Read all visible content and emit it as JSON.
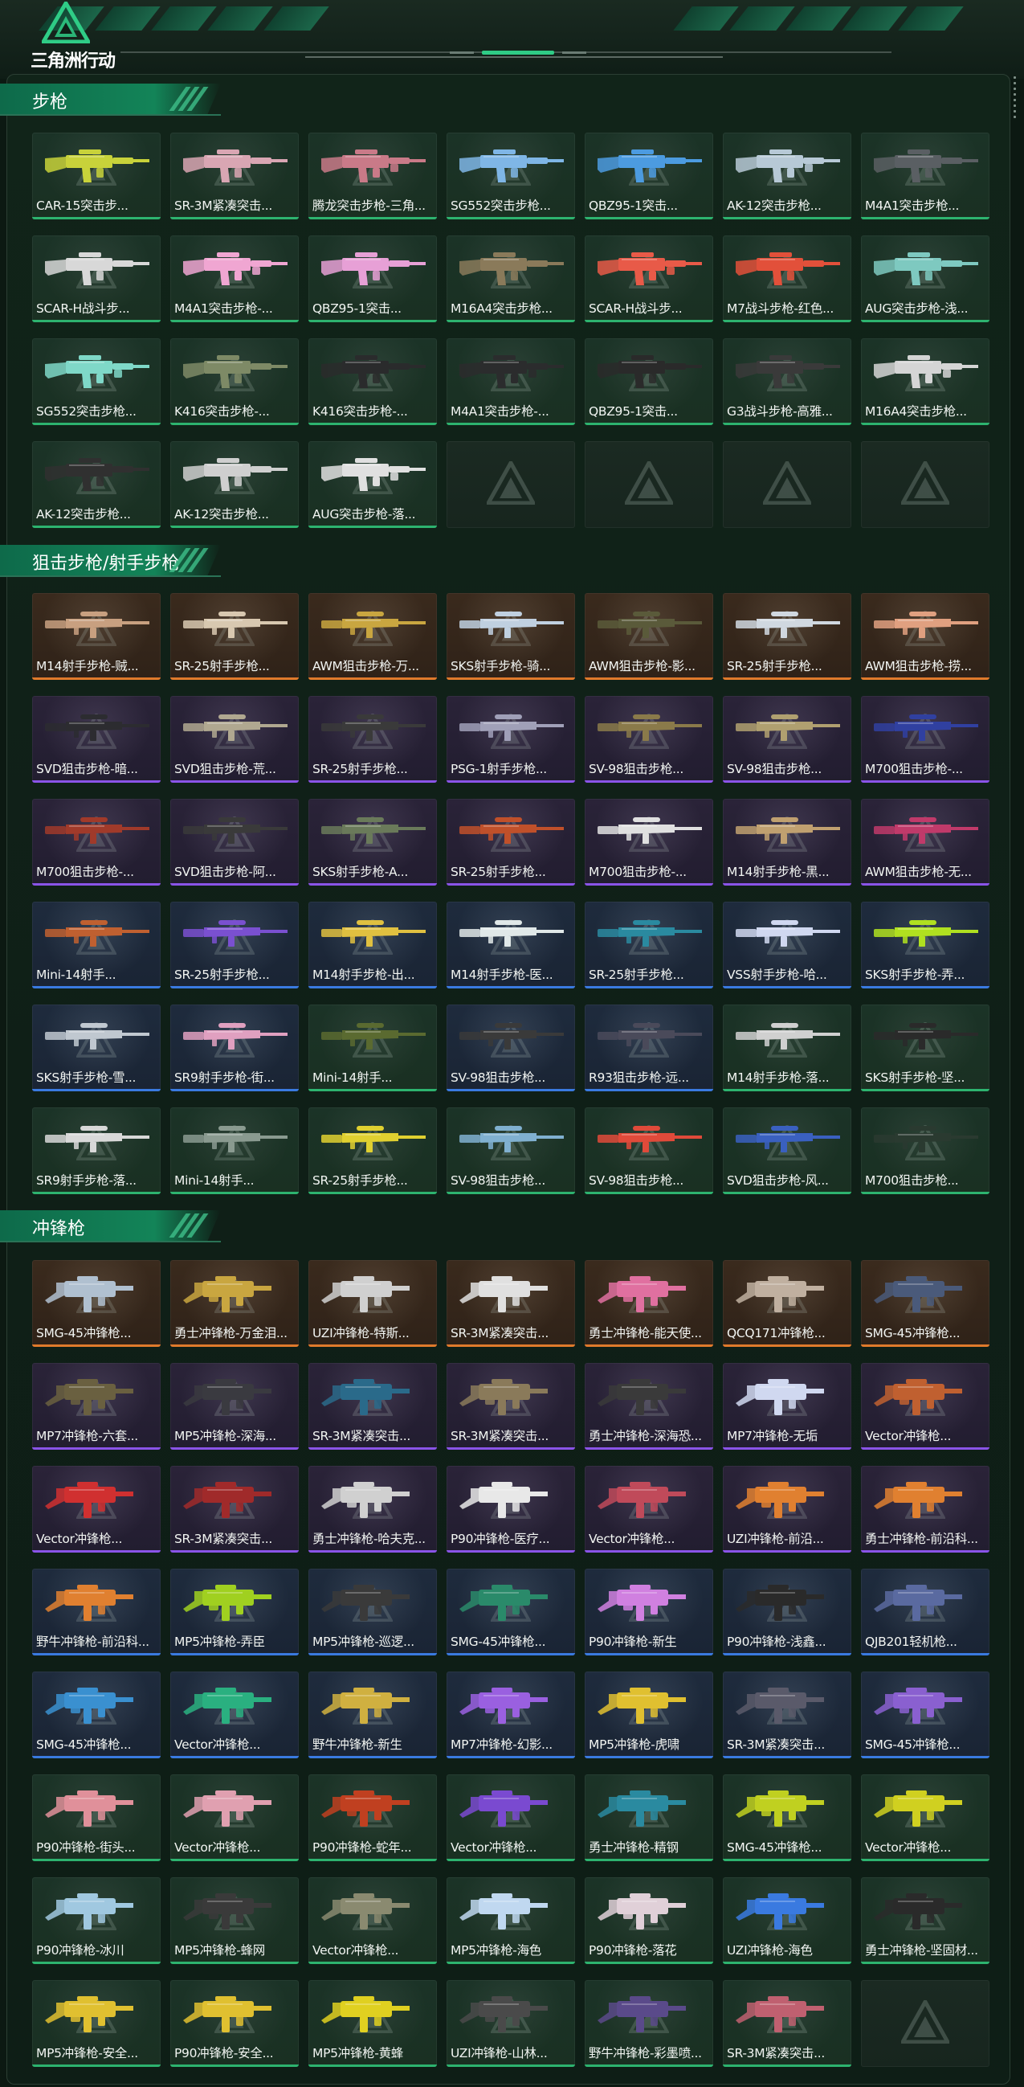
{
  "app": {
    "title": "三角洲行动",
    "accent_color": "#2fcc86"
  },
  "sections": [
    {
      "title": "步枪",
      "items": [
        {
          "label": "CAR-15突击步...",
          "rarity": "green",
          "icon": "assault-rifle-icon",
          "color": "#c8d23a"
        },
        {
          "label": "SR-3M紧凑突击...",
          "rarity": "green",
          "icon": "assault-rifle-icon",
          "color": "#d9a6b3"
        },
        {
          "label": "腾龙突击步枪-三角...",
          "rarity": "green",
          "icon": "assault-rifle-icon",
          "color": "#c97a88"
        },
        {
          "label": "SG552突击步枪...",
          "rarity": "green",
          "icon": "assault-rifle-icon",
          "color": "#7fb6e6"
        },
        {
          "label": "QBZ95-1突击...",
          "rarity": "green",
          "icon": "assault-rifle-icon",
          "color": "#4c9be0"
        },
        {
          "label": "AK-12突击步枪...",
          "rarity": "green",
          "icon": "assault-rifle-icon",
          "color": "#b7c9d6"
        },
        {
          "label": "M4A1突击步枪...",
          "rarity": "green",
          "icon": "assault-rifle-icon",
          "color": "#5a5f63"
        },
        {
          "label": "SCAR-H战斗步...",
          "rarity": "green",
          "icon": "assault-rifle-icon",
          "color": "#d8d8d8"
        },
        {
          "label": "M4A1突击步枪-...",
          "rarity": "green",
          "icon": "assault-rifle-icon",
          "color": "#f0a6d2"
        },
        {
          "label": "QBZ95-1突击...",
          "rarity": "green",
          "icon": "assault-rifle-icon",
          "color": "#e7a0d6"
        },
        {
          "label": "M16A4突击步枪...",
          "rarity": "green",
          "icon": "assault-rifle-icon",
          "color": "#8a7a5a"
        },
        {
          "label": "SCAR-H战斗步...",
          "rarity": "green",
          "icon": "assault-rifle-icon",
          "color": "#e85a48"
        },
        {
          "label": "M7战斗步枪-红色...",
          "rarity": "green",
          "icon": "assault-rifle-icon",
          "color": "#e2503a"
        },
        {
          "label": "AUG突击步枪-浅...",
          "rarity": "green",
          "icon": "assault-rifle-icon",
          "color": "#7ec9c0"
        },
        {
          "label": "SG552突击步枪...",
          "rarity": "green",
          "icon": "assault-rifle-icon",
          "color": "#7fd8c8"
        },
        {
          "label": "K416突击步枪-...",
          "rarity": "green",
          "icon": "assault-rifle-icon",
          "color": "#7e8a66"
        },
        {
          "label": "K416突击步枪-...",
          "rarity": "green",
          "icon": "assault-rifle-icon",
          "color": "#2a2b2c"
        },
        {
          "label": "M4A1突击步枪-...",
          "rarity": "green",
          "icon": "assault-rifle-icon",
          "color": "#2b2c2d"
        },
        {
          "label": "QBZ95-1突击...",
          "rarity": "green",
          "icon": "assault-rifle-icon",
          "color": "#2a2a2a"
        },
        {
          "label": "G3战斗步枪-高雅...",
          "rarity": "green",
          "icon": "assault-rifle-icon",
          "color": "#3a3a3a"
        },
        {
          "label": "M16A4突击步枪...",
          "rarity": "green",
          "icon": "assault-rifle-icon",
          "color": "#d5d5d5"
        },
        {
          "label": "AK-12突击步枪...",
          "rarity": "green",
          "icon": "assault-rifle-icon",
          "color": "#303030"
        },
        {
          "label": "AK-12突击步枪...",
          "rarity": "green",
          "icon": "assault-rifle-icon",
          "color": "#cfcfcf"
        },
        {
          "label": "AUG突击步枪-落...",
          "rarity": "green",
          "icon": "assault-rifle-icon",
          "color": "#e0e0e0"
        },
        {
          "label": "",
          "rarity": "empty",
          "icon": "delta-watermark-icon",
          "color": ""
        },
        {
          "label": "",
          "rarity": "empty",
          "icon": "delta-watermark-icon",
          "color": ""
        },
        {
          "label": "",
          "rarity": "empty",
          "icon": "delta-watermark-icon",
          "color": ""
        },
        {
          "label": "",
          "rarity": "empty",
          "icon": "delta-watermark-icon",
          "color": ""
        }
      ]
    },
    {
      "title": "狙击步枪/射手步枪",
      "items": [
        {
          "label": "M14射手步枪-贼...",
          "rarity": "orange",
          "icon": "sniper-rifle-icon",
          "color": "#c8a080"
        },
        {
          "label": "SR-25射手步枪...",
          "rarity": "orange",
          "icon": "sniper-rifle-icon",
          "color": "#d8c8b0"
        },
        {
          "label": "AWM狙击步枪-万...",
          "rarity": "orange",
          "icon": "sniper-rifle-icon",
          "color": "#c9a640"
        },
        {
          "label": "SKS射手步枪-骑...",
          "rarity": "orange",
          "icon": "sniper-rifle-icon",
          "color": "#c0d0e0"
        },
        {
          "label": "AWM狙击步枪-影...",
          "rarity": "orange",
          "icon": "sniper-rifle-icon",
          "color": "#5a5a3a"
        },
        {
          "label": "SR-25射手步枪...",
          "rarity": "orange",
          "icon": "sniper-rifle-icon",
          "color": "#d0d8e0"
        },
        {
          "label": "AWM狙击步枪-捞...",
          "rarity": "orange",
          "icon": "sniper-rifle-icon",
          "color": "#e0a080"
        },
        {
          "label": "SVD狙击步枪-暗...",
          "rarity": "purple",
          "icon": "sniper-rifle-icon",
          "color": "#2c2c30"
        },
        {
          "label": "SVD狙击步枪-荒...",
          "rarity": "purple",
          "icon": "sniper-rifle-icon",
          "color": "#b0a890"
        },
        {
          "label": "SR-25射手步枪...",
          "rarity": "purple",
          "icon": "sniper-rifle-icon",
          "color": "#3a3a3a"
        },
        {
          "label": "PSG-1射手步枪...",
          "rarity": "purple",
          "icon": "sniper-rifle-icon",
          "color": "#a0a0b8"
        },
        {
          "label": "SV-98狙击步枪...",
          "rarity": "purple",
          "icon": "sniper-rifle-icon",
          "color": "#8a7a4a"
        },
        {
          "label": "SV-98狙击步枪...",
          "rarity": "purple",
          "icon": "sniper-rifle-icon",
          "color": "#b0a070"
        },
        {
          "label": "M700狙击步枪-...",
          "rarity": "purple",
          "icon": "sniper-rifle-icon",
          "color": "#3040a0"
        },
        {
          "label": "M700狙击步枪-...",
          "rarity": "purple",
          "icon": "sniper-rifle-icon",
          "color": "#a03a2a"
        },
        {
          "label": "SVD狙击步枪-阿...",
          "rarity": "purple",
          "icon": "sniper-rifle-icon",
          "color": "#3a3a3a"
        },
        {
          "label": "SKS射手步枪-A...",
          "rarity": "purple",
          "icon": "sniper-rifle-icon",
          "color": "#6a7a5a"
        },
        {
          "label": "SR-25射手步枪...",
          "rarity": "purple",
          "icon": "sniper-rifle-icon",
          "color": "#c0502a"
        },
        {
          "label": "M700狙击步枪-...",
          "rarity": "purple",
          "icon": "sniper-rifle-icon",
          "color": "#e0e0e0"
        },
        {
          "label": "M14射手步枪-黑...",
          "rarity": "purple",
          "icon": "sniper-rifle-icon",
          "color": "#c0a070"
        },
        {
          "label": "AWM狙击步枪-无...",
          "rarity": "purple",
          "icon": "sniper-rifle-icon",
          "color": "#c03a6a"
        },
        {
          "label": "Mini-14射手...",
          "rarity": "blue",
          "icon": "sniper-rifle-icon",
          "color": "#c06030"
        },
        {
          "label": "SR-25射手步枪...",
          "rarity": "blue",
          "icon": "sniper-rifle-icon",
          "color": "#7a50d0"
        },
        {
          "label": "M14射手步枪-出...",
          "rarity": "blue",
          "icon": "sniper-rifle-icon",
          "color": "#e0c040"
        },
        {
          "label": "M14射手步枪-医...",
          "rarity": "blue",
          "icon": "sniper-rifle-icon",
          "color": "#e0e8e8"
        },
        {
          "label": "SR-25射手步枪...",
          "rarity": "blue",
          "icon": "sniper-rifle-icon",
          "color": "#2a8aa0"
        },
        {
          "label": "VSS射手步枪-哈...",
          "rarity": "blue",
          "icon": "sniper-rifle-icon",
          "color": "#d0d8f0"
        },
        {
          "label": "SKS射手步枪-弄...",
          "rarity": "blue",
          "icon": "sniper-rifle-icon",
          "color": "#b0e020"
        },
        {
          "label": "SKS射手步枪-雪...",
          "rarity": "blue",
          "icon": "sniper-rifle-icon",
          "color": "#c0c8d0"
        },
        {
          "label": "SR9射手步枪-街...",
          "rarity": "blue",
          "icon": "sniper-rifle-icon",
          "color": "#e0a0c0"
        },
        {
          "label": "Mini-14射手...",
          "rarity": "green",
          "icon": "sniper-rifle-icon",
          "color": "#5a6a30"
        },
        {
          "label": "SV-98狙击步枪...",
          "rarity": "blue",
          "icon": "sniper-rifle-icon",
          "color": "#3a3a3a"
        },
        {
          "label": "R93狙击步枪-远...",
          "rarity": "blue",
          "icon": "sniper-rifle-icon",
          "color": "#4a4a5a"
        },
        {
          "label": "M14射手步枪-落...",
          "rarity": "green",
          "icon": "sniper-rifle-icon",
          "color": "#d0d0d0"
        },
        {
          "label": "SKS射手步枪-坚...",
          "rarity": "green",
          "icon": "sniper-rifle-icon",
          "color": "#2a2a2a"
        },
        {
          "label": "SR9射手步枪-落...",
          "rarity": "green",
          "icon": "sniper-rifle-icon",
          "color": "#d8d8d8"
        },
        {
          "label": "Mini-14射手...",
          "rarity": "green",
          "icon": "sniper-rifle-icon",
          "color": "#8a9a90"
        },
        {
          "label": "SR-25射手步枪...",
          "rarity": "green",
          "icon": "sniper-rifle-icon",
          "color": "#e0d030"
        },
        {
          "label": "SV-98狙击步枪...",
          "rarity": "green",
          "icon": "sniper-rifle-icon",
          "color": "#80b0d0"
        },
        {
          "label": "SV-98狙击步枪...",
          "rarity": "green",
          "icon": "sniper-rifle-icon",
          "color": "#e04a3a"
        },
        {
          "label": "SVD狙击步枪-风...",
          "rarity": "green",
          "icon": "sniper-rifle-icon",
          "color": "#3a60c0"
        },
        {
          "label": "M700狙击步枪...",
          "rarity": "green",
          "icon": "sniper-rifle-icon",
          "color": "#2a3a30"
        }
      ]
    },
    {
      "title": "冲锋枪",
      "items": [
        {
          "label": "SMG-45冲锋枪...",
          "rarity": "orange",
          "icon": "smg-icon",
          "color": "#b0c0d0"
        },
        {
          "label": "勇士冲锋枪-万金泪...",
          "rarity": "orange",
          "icon": "smg-icon",
          "color": "#c9a640"
        },
        {
          "label": "UZI冲锋枪-特斯...",
          "rarity": "orange",
          "icon": "smg-icon",
          "color": "#d0d0d0"
        },
        {
          "label": "SR-3M紧凑突击...",
          "rarity": "orange",
          "icon": "smg-icon",
          "color": "#e0e0e0"
        },
        {
          "label": "勇士冲锋枪-能天使...",
          "rarity": "orange",
          "icon": "smg-icon",
          "color": "#e070a0"
        },
        {
          "label": "QCQ171冲锋枪...",
          "rarity": "orange",
          "icon": "smg-icon",
          "color": "#c0b0a0"
        },
        {
          "label": "SMG-45冲锋枪...",
          "rarity": "orange",
          "icon": "smg-icon",
          "color": "#4a5a7a"
        },
        {
          "label": "MP7冲锋枪-六套...",
          "rarity": "purple",
          "icon": "smg-icon",
          "color": "#6a6040"
        },
        {
          "label": "MP5冲锋枪-深海...",
          "rarity": "purple",
          "icon": "smg-icon",
          "color": "#3a3a40"
        },
        {
          "label": "SR-3M紧凑突击...",
          "rarity": "purple",
          "icon": "smg-icon",
          "color": "#2a6a8a"
        },
        {
          "label": "SR-3M紧凑突击...",
          "rarity": "purple",
          "icon": "smg-icon",
          "color": "#8a7a5a"
        },
        {
          "label": "勇士冲锋枪-深海恐...",
          "rarity": "purple",
          "icon": "smg-icon",
          "color": "#3a3a3a"
        },
        {
          "label": "MP7冲锋枪-无垢",
          "rarity": "purple",
          "icon": "smg-icon",
          "color": "#d0d8f0"
        },
        {
          "label": "Vector冲锋枪...",
          "rarity": "purple",
          "icon": "smg-icon",
          "color": "#c06030"
        },
        {
          "label": "Vector冲锋枪...",
          "rarity": "purple",
          "icon": "smg-icon",
          "color": "#d03030"
        },
        {
          "label": "SR-3M紧凑突击...",
          "rarity": "purple",
          "icon": "smg-icon",
          "color": "#a02a2a"
        },
        {
          "label": "勇士冲锋枪-哈夫克...",
          "rarity": "purple",
          "icon": "smg-icon",
          "color": "#d0d0d0"
        },
        {
          "label": "P90冲锋枪-医疗...",
          "rarity": "purple",
          "icon": "smg-icon",
          "color": "#e8e8e8"
        },
        {
          "label": "Vector冲锋枪...",
          "rarity": "purple",
          "icon": "smg-icon",
          "color": "#c04a5a"
        },
        {
          "label": "UZI冲锋枪-前沿...",
          "rarity": "purple",
          "icon": "smg-icon",
          "color": "#e08030"
        },
        {
          "label": "勇士冲锋枪-前沿科...",
          "rarity": "purple",
          "icon": "smg-icon",
          "color": "#e08030"
        },
        {
          "label": "野牛冲锋枪-前沿科...",
          "rarity": "blue",
          "icon": "smg-icon",
          "color": "#e08030"
        },
        {
          "label": "MP5冲锋枪-弄臣",
          "rarity": "blue",
          "icon": "smg-icon",
          "color": "#a0d020"
        },
        {
          "label": "MP5冲锋枪-巡逻...",
          "rarity": "blue",
          "icon": "smg-icon",
          "color": "#3a3a3a"
        },
        {
          "label": "SMG-45冲锋枪...",
          "rarity": "blue",
          "icon": "smg-icon",
          "color": "#2a8a6a"
        },
        {
          "label": "P90冲锋枪-新生",
          "rarity": "blue",
          "icon": "smg-icon",
          "color": "#d080e0"
        },
        {
          "label": "P90冲锋枪-浅鑫...",
          "rarity": "blue",
          "icon": "smg-icon",
          "color": "#2a2a2a"
        },
        {
          "label": "QJB201轻机枪...",
          "rarity": "blue",
          "icon": "smg-icon",
          "color": "#5a6aa0"
        },
        {
          "label": "SMG-45冲锋枪...",
          "rarity": "blue",
          "icon": "smg-icon",
          "color": "#3a90d0"
        },
        {
          "label": "Vector冲锋枪...",
          "rarity": "blue",
          "icon": "smg-icon",
          "color": "#2ab080"
        },
        {
          "label": "野牛冲锋枪-新生",
          "rarity": "blue",
          "icon": "smg-icon",
          "color": "#d0b040"
        },
        {
          "label": "MP7冲锋枪-幻影...",
          "rarity": "blue",
          "icon": "smg-icon",
          "color": "#9a60e0"
        },
        {
          "label": "MP5冲锋枪-虎啸",
          "rarity": "blue",
          "icon": "smg-icon",
          "color": "#e0c030"
        },
        {
          "label": "SR-3M紧凑突击...",
          "rarity": "blue",
          "icon": "smg-icon",
          "color": "#5a5a6a"
        },
        {
          "label": "SMG-45冲锋枪...",
          "rarity": "blue",
          "icon": "smg-icon",
          "color": "#8a60d0"
        },
        {
          "label": "P90冲锋枪-街头...",
          "rarity": "green",
          "icon": "smg-icon",
          "color": "#e0909a"
        },
        {
          "label": "Vector冲锋枪...",
          "rarity": "green",
          "icon": "smg-icon",
          "color": "#e0a0b0"
        },
        {
          "label": "P90冲锋枪-蛇年...",
          "rarity": "green",
          "icon": "smg-icon",
          "color": "#c04020"
        },
        {
          "label": "Vector冲锋枪...",
          "rarity": "green",
          "icon": "smg-icon",
          "color": "#7a4ad0"
        },
        {
          "label": "勇士冲锋枪-精钢",
          "rarity": "green",
          "icon": "smg-icon",
          "color": "#2a8aa0"
        },
        {
          "label": "SMG-45冲锋枪...",
          "rarity": "green",
          "icon": "smg-icon",
          "color": "#c0d020"
        },
        {
          "label": "Vector冲锋枪...",
          "rarity": "green",
          "icon": "smg-icon",
          "color": "#d0d020"
        },
        {
          "label": "P90冲锋枪-冰川",
          "rarity": "green",
          "icon": "smg-icon",
          "color": "#a0c8e0"
        },
        {
          "label": "MP5冲锋枪-蜂网",
          "rarity": "green",
          "icon": "smg-icon",
          "color": "#3a3a3a"
        },
        {
          "label": "Vector冲锋枪...",
          "rarity": "green",
          "icon": "smg-icon",
          "color": "#8a8a70"
        },
        {
          "label": "MP5冲锋枪-海色",
          "rarity": "green",
          "icon": "smg-icon",
          "color": "#c0d8f0"
        },
        {
          "label": "P90冲锋枪-落花",
          "rarity": "green",
          "icon": "smg-icon",
          "color": "#e0d0d8"
        },
        {
          "label": "UZI冲锋枪-海色",
          "rarity": "green",
          "icon": "smg-icon",
          "color": "#3a7ae0"
        },
        {
          "label": "勇士冲锋枪-坚固材...",
          "rarity": "green",
          "icon": "smg-icon",
          "color": "#2a2a2a"
        },
        {
          "label": "MP5冲锋枪-安全...",
          "rarity": "green",
          "icon": "smg-icon",
          "color": "#e0c030"
        },
        {
          "label": "P90冲锋枪-安全...",
          "rarity": "green",
          "icon": "smg-icon",
          "color": "#e0c030"
        },
        {
          "label": "MP5冲锋枪-黄蜂",
          "rarity": "green",
          "icon": "smg-icon",
          "color": "#e0d020"
        },
        {
          "label": "UZI冲锋枪-山林...",
          "rarity": "green",
          "icon": "smg-icon",
          "color": "#4a4a4a"
        },
        {
          "label": "野牛冲锋枪-彩墨喷...",
          "rarity": "green",
          "icon": "smg-icon",
          "color": "#5a4a8a"
        },
        {
          "label": "SR-3M紧凑突击...",
          "rarity": "green",
          "icon": "smg-icon",
          "color": "#c06070"
        },
        {
          "label": "",
          "rarity": "empty",
          "icon": "delta-watermark-icon",
          "color": ""
        }
      ]
    }
  ]
}
